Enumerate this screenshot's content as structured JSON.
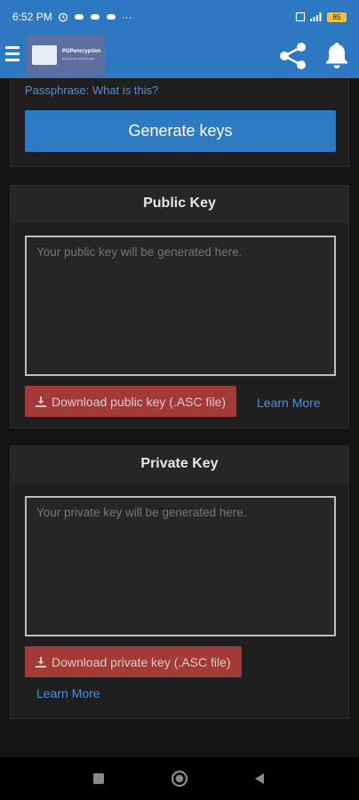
{
  "status_bar": {
    "time": "6:52 PM",
    "extra": "···",
    "battery": "85"
  },
  "app_bar": {
    "logo_title": "PGPencryption",
    "logo_subtitle": "Encrypt and decrypt data"
  },
  "generator": {
    "passphrase_label": "Passphrase: What is this?",
    "generate_label": "Generate keys"
  },
  "public_key": {
    "title": "Public Key",
    "placeholder": "Your public key will be generated here.",
    "download_label": "Download public key (.ASC file)",
    "learn_more": "Learn More"
  },
  "private_key": {
    "title": "Private Key",
    "placeholder": "Your private key will be generated here.",
    "download_label": "Download private key (.ASC file)",
    "learn_more": "Learn More"
  },
  "colors": {
    "accent": "#2d78c0",
    "danger": "#a33a38",
    "link": "#4a90d9",
    "background": "#141414"
  },
  "icons": [
    "menu-icon",
    "share-icon",
    "bell-icon",
    "download-icon",
    "square-nav-icon",
    "circle-nav-icon",
    "back-nav-icon"
  ]
}
